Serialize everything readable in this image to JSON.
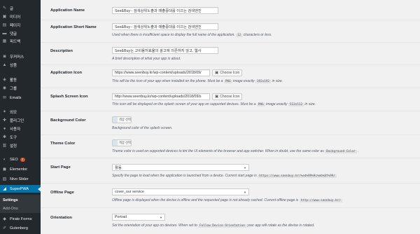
{
  "sidebar": {
    "items": [
      {
        "label": "글",
        "icon": "pin-icon",
        "glyph": "✎"
      },
      {
        "label": "미디어",
        "icon": "media-icon",
        "glyph": "▣"
      },
      {
        "label": "페이지",
        "icon": "page-icon",
        "glyph": "▤"
      },
      {
        "label": "댓글",
        "icon": "comment-icon",
        "glyph": "▬"
      },
      {
        "label": "피드백",
        "icon": "feedback-icon",
        "glyph": "▦"
      },
      {
        "label": "우커머스",
        "icon": "woocommerce-icon",
        "glyph": "◙"
      },
      {
        "label": "상품",
        "icon": "products-icon",
        "glyph": "▲"
      },
      {
        "label": "활동",
        "icon": "activity-icon",
        "glyph": "◈"
      },
      {
        "label": "그룹",
        "icon": "groups-icon",
        "glyph": "◉"
      },
      {
        "label": "Emails",
        "icon": "email-icon",
        "glyph": "✉"
      },
      {
        "label": "외모",
        "icon": "appearance-icon",
        "glyph": "✦"
      },
      {
        "label": "플러그인",
        "icon": "plugins-icon",
        "glyph": "✚"
      },
      {
        "label": "사용자",
        "icon": "users-icon",
        "glyph": "●"
      },
      {
        "label": "도구",
        "icon": "tools-icon",
        "glyph": "✱"
      },
      {
        "label": "설정",
        "icon": "settings-icon",
        "glyph": "▥"
      },
      {
        "label": "SEO",
        "icon": "seo-icon",
        "glyph": "◐",
        "badge": "1"
      },
      {
        "label": "Elementor",
        "icon": "elementor-icon",
        "glyph": "◼"
      },
      {
        "label": "Nivo Slider",
        "icon": "slider-icon",
        "glyph": "▧"
      },
      {
        "label": "SuperPWA",
        "icon": "superpwa-icon",
        "glyph": "◢",
        "active": true
      }
    ],
    "submenu": [
      {
        "label": "Settings",
        "current": true
      },
      {
        "label": "Add-Ons",
        "current": false
      }
    ],
    "bottom_items": [
      {
        "label": "Pirate Forms",
        "icon": "pirate-forms-icon",
        "glyph": "◆"
      },
      {
        "label": "Gutenberg",
        "icon": "gutenberg-icon",
        "glyph": "✐"
      }
    ]
  },
  "settings": {
    "app_name": {
      "label": "Application Name",
      "value": "See&Buy - 검색상위노출과 매출증대를 이끄는 검색엔진"
    },
    "app_short_name": {
      "label": "Application Short Name",
      "value": "See&Buy - 검색상위노출과 매출증대를 이끄는 검색엔진",
      "desc_pre": "Used when there is insufficient space to display the full name of the application.",
      "desc_code": "12",
      "desc_post": "characters or less."
    },
    "description": {
      "label": "Description",
      "value": "See&Buy는 고비용저효율의 광고에 의존하지 않고, 웹사",
      "desc": "A brief description of what your app is about."
    },
    "app_icon": {
      "label": "Application Icon",
      "value": "https://www.seenbuy.kr/wp-content/uploads/2018/09/",
      "button": "Choose Icon",
      "desc_pre": "This will be the icon of your app when installed on the phone. Must be a",
      "desc_code1": "PNG",
      "desc_mid": "image exactly",
      "desc_code2": "192x192",
      "desc_post": "in size."
    },
    "splash_icon": {
      "label": "Splash Screen Icon",
      "value": "http://www.seenbuy.kr/wp-content/uploads/2018/09/s",
      "button": "Choose Icon",
      "desc_pre": "This icon will be displayed on the splash screen of your app on supported devices. Must be a",
      "desc_code1": "PNG",
      "desc_mid": "image exactly",
      "desc_code2": "512x512",
      "desc_post": "in size."
    },
    "bg_color": {
      "label": "Background Color",
      "button": "색상 선택",
      "swatch": "#d8e4ee",
      "desc": "Background color of the splash screen."
    },
    "theme_color": {
      "label": "Theme Color",
      "button": "색상 선택",
      "swatch": "#d8e4ee",
      "desc_pre": "Theme color is used on supported devices to tint the UI elements of the browser and app switcher. When in doubt, use the same color as",
      "desc_code": "Background Color",
      "desc_post": "."
    },
    "start_page": {
      "label": "Start Page",
      "value": "활동",
      "desc_pre": "Specify the page to load when the application is launched from a device. Current start page is",
      "desc_code": "https://www.seenbuy.kr/%ed%99%9c%eb%8f%99/"
    },
    "offline_page": {
      "label": "Offline Page",
      "value": "cover_our service",
      "desc_pre": "Offline page is displayed when the device is offline and the requested page is not already cached. Current offline page is",
      "desc_code": "http://www.seenbuy.kr/"
    },
    "orientation": {
      "label": "Orientation",
      "value": "Portrait",
      "desc_pre": "Set the orientation of your app on devices. When set to",
      "desc_code": "Follow Device Orientation",
      "desc_post": "your app will rotate as the device is rotated."
    }
  },
  "colors": {
    "sidebar_bg": "#23282d",
    "active_bg": "#0073aa",
    "page_bg": "#f1f1f1"
  }
}
